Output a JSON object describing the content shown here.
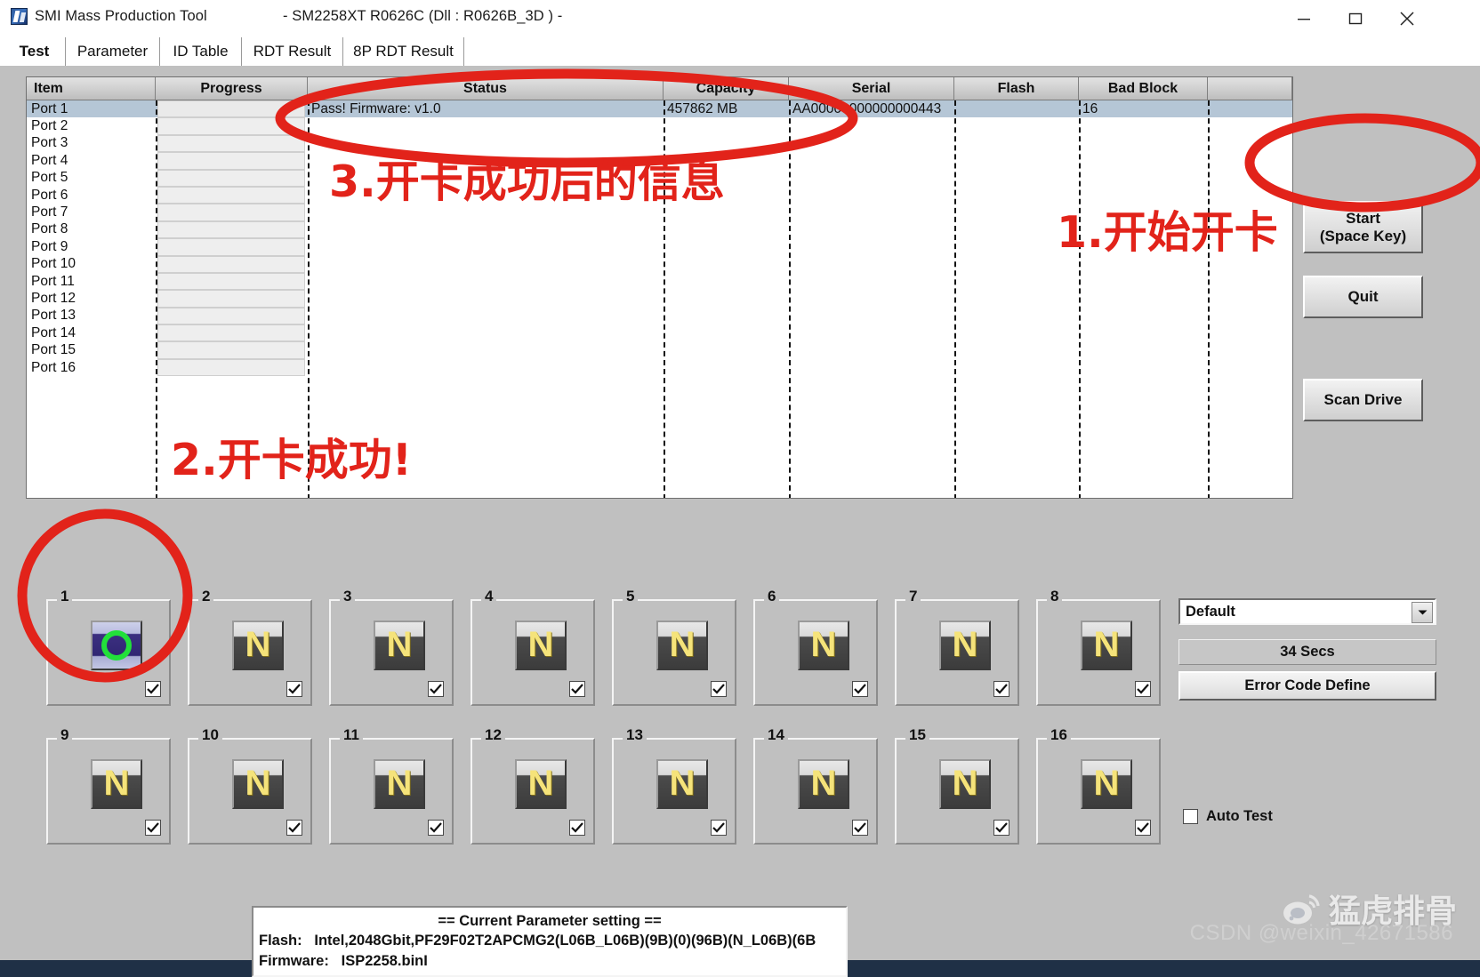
{
  "window": {
    "title": "SMI Mass Production Tool",
    "subtitle": "- SM2258XT   R0626C    (Dll : R0626B_3D ) -",
    "app_icon": "smi-app-icon",
    "controls": {
      "minimize": "minimize-icon",
      "maximize": "maximize-icon",
      "close": "close-icon"
    }
  },
  "tabs": [
    {
      "label": "Test",
      "selected": true
    },
    {
      "label": "Parameter",
      "selected": false
    },
    {
      "label": "ID Table",
      "selected": false
    },
    {
      "label": "RDT Result",
      "selected": false
    },
    {
      "label": "8P RDT Result",
      "selected": false
    }
  ],
  "grid": {
    "columns": [
      "Item",
      "Progress",
      "Status",
      "Capacity",
      "Serial",
      "Flash",
      "Bad Block"
    ],
    "rows": [
      {
        "item": "Port 1",
        "progress": "",
        "status": "Pass!  Firmware: v1.0",
        "capacity": "457862 MB",
        "serial": "AA00000000000000443",
        "flash": "",
        "bad_block": "16",
        "selected": true
      },
      {
        "item": "Port 2",
        "progress": "",
        "status": "",
        "capacity": "",
        "serial": "",
        "flash": "",
        "bad_block": "",
        "selected": false
      },
      {
        "item": "Port 3",
        "progress": "",
        "status": "",
        "capacity": "",
        "serial": "",
        "flash": "",
        "bad_block": "",
        "selected": false
      },
      {
        "item": "Port 4",
        "progress": "",
        "status": "",
        "capacity": "",
        "serial": "",
        "flash": "",
        "bad_block": "",
        "selected": false
      },
      {
        "item": "Port 5",
        "progress": "",
        "status": "",
        "capacity": "",
        "serial": "",
        "flash": "",
        "bad_block": "",
        "selected": false
      },
      {
        "item": "Port 6",
        "progress": "",
        "status": "",
        "capacity": "",
        "serial": "",
        "flash": "",
        "bad_block": "",
        "selected": false
      },
      {
        "item": "Port 7",
        "progress": "",
        "status": "",
        "capacity": "",
        "serial": "",
        "flash": "",
        "bad_block": "",
        "selected": false
      },
      {
        "item": "Port 8",
        "progress": "",
        "status": "",
        "capacity": "",
        "serial": "",
        "flash": "",
        "bad_block": "",
        "selected": false
      },
      {
        "item": "Port 9",
        "progress": "",
        "status": "",
        "capacity": "",
        "serial": "",
        "flash": "",
        "bad_block": "",
        "selected": false
      },
      {
        "item": "Port 10",
        "progress": "",
        "status": "",
        "capacity": "",
        "serial": "",
        "flash": "",
        "bad_block": "",
        "selected": false
      },
      {
        "item": "Port 11",
        "progress": "",
        "status": "",
        "capacity": "",
        "serial": "",
        "flash": "",
        "bad_block": "",
        "selected": false
      },
      {
        "item": "Port 12",
        "progress": "",
        "status": "",
        "capacity": "",
        "serial": "",
        "flash": "",
        "bad_block": "",
        "selected": false
      },
      {
        "item": "Port 13",
        "progress": "",
        "status": "",
        "capacity": "",
        "serial": "",
        "flash": "",
        "bad_block": "",
        "selected": false
      },
      {
        "item": "Port 14",
        "progress": "",
        "status": "",
        "capacity": "",
        "serial": "",
        "flash": "",
        "bad_block": "",
        "selected": false
      },
      {
        "item": "Port 15",
        "progress": "",
        "status": "",
        "capacity": "",
        "serial": "",
        "flash": "",
        "bad_block": "",
        "selected": false
      },
      {
        "item": "Port 16",
        "progress": "",
        "status": "",
        "capacity": "",
        "serial": "",
        "flash": "",
        "bad_block": "",
        "selected": false
      }
    ]
  },
  "side_buttons": {
    "start_line1": "Start",
    "start_line2": "(Space Key)",
    "quit": "Quit",
    "scan_drive": "Scan Drive"
  },
  "tiles": [
    {
      "num": "1",
      "state": "pass",
      "glyph": "O",
      "checked": true
    },
    {
      "num": "2",
      "state": "none",
      "glyph": "N",
      "checked": true
    },
    {
      "num": "3",
      "state": "none",
      "glyph": "N",
      "checked": true
    },
    {
      "num": "4",
      "state": "none",
      "glyph": "N",
      "checked": true
    },
    {
      "num": "5",
      "state": "none",
      "glyph": "N",
      "checked": true
    },
    {
      "num": "6",
      "state": "none",
      "glyph": "N",
      "checked": true
    },
    {
      "num": "7",
      "state": "none",
      "glyph": "N",
      "checked": true
    },
    {
      "num": "8",
      "state": "none",
      "glyph": "N",
      "checked": true
    },
    {
      "num": "9",
      "state": "none",
      "glyph": "N",
      "checked": true
    },
    {
      "num": "10",
      "state": "none",
      "glyph": "N",
      "checked": true
    },
    {
      "num": "11",
      "state": "none",
      "glyph": "N",
      "checked": true
    },
    {
      "num": "12",
      "state": "none",
      "glyph": "N",
      "checked": true
    },
    {
      "num": "13",
      "state": "none",
      "glyph": "N",
      "checked": true
    },
    {
      "num": "14",
      "state": "none",
      "glyph": "N",
      "checked": true
    },
    {
      "num": "15",
      "state": "none",
      "glyph": "N",
      "checked": true
    },
    {
      "num": "16",
      "state": "none",
      "glyph": "N",
      "checked": true
    }
  ],
  "right_controls": {
    "profile_selected": "Default",
    "profile_options": [
      "Default"
    ],
    "timer": "34 Secs",
    "error_code_define": "Error Code Define",
    "auto_test_label": "Auto Test",
    "auto_test_checked": false
  },
  "parameter_box": {
    "title": "== Current Parameter setting ==",
    "flash_label": "Flash:",
    "flash_value": "Intel,2048Gbit,PF29F02T2APCMG2(L06B_L06B)(9B)(0)(96B)(N_L06B)(6B",
    "firmware_label": "Firmware:",
    "firmware_value": "ISP2258.binI"
  },
  "annotations": [
    {
      "id": "ann1",
      "text": "1.开始开卡"
    },
    {
      "id": "ann2",
      "text": "2.开卡成功!"
    },
    {
      "id": "ann3",
      "text": "3.开卡成功后的信息"
    }
  ],
  "watermarks": {
    "weibo_name": "猛虎排骨",
    "csdn": "CSDN @weixin_42671586"
  },
  "colors": {
    "annotation_red": "#e2231a",
    "pass_led_green": "#22e03a",
    "led_yellow": "#f5e37a",
    "window_face": "#c0c0c0",
    "selected_row": "#b5c6d6"
  }
}
